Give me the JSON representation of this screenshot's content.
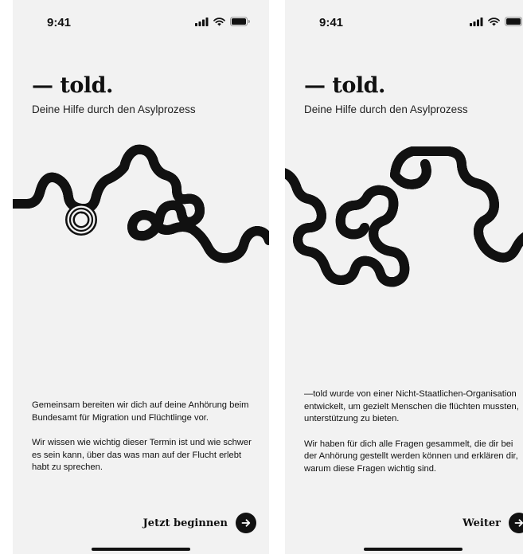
{
  "colors": {
    "background": "#f2f2f2",
    "ink": "#111111"
  },
  "screens": [
    {
      "status": {
        "time": "9:41",
        "icons": [
          "signal-icon",
          "wifi-icon",
          "battery-icon"
        ]
      },
      "brand": "— told.",
      "tagline": "Deine Hilfe durch den Asylprozess",
      "paragraphs": [
        "Gemeinsam bereiten wir dich auf deine Anhörung beim Bundesamt für Migration und Flüchtlinge vor.",
        "Wir wissen wie wichtig dieser Termin ist und wie schwer es sein kann, über das was man auf der Flucht erlebt habt zu sprechen."
      ],
      "cta_label": "Jetzt beginnen",
      "cta_icon": "arrow-right-icon"
    },
    {
      "status": {
        "time": "9:41",
        "icons": [
          "signal-icon",
          "wifi-icon",
          "battery-icon"
        ]
      },
      "brand": "— told.",
      "tagline": "Deine Hilfe durch den Asylprozess",
      "paragraphs": [
        "—told wurde von einer Nicht-Staatlichen-Organisation entwickelt, um gezielt Menschen die flüchten mussten, unterstützung zu bieten.",
        "Wir haben für dich alle Fragen gesammelt, die dir bei der Anhörung gestellt werden können und erklären dir, warum diese Fragen wichtig sind."
      ],
      "cta_label": "Weiter",
      "cta_icon": "arrow-right-icon"
    }
  ]
}
